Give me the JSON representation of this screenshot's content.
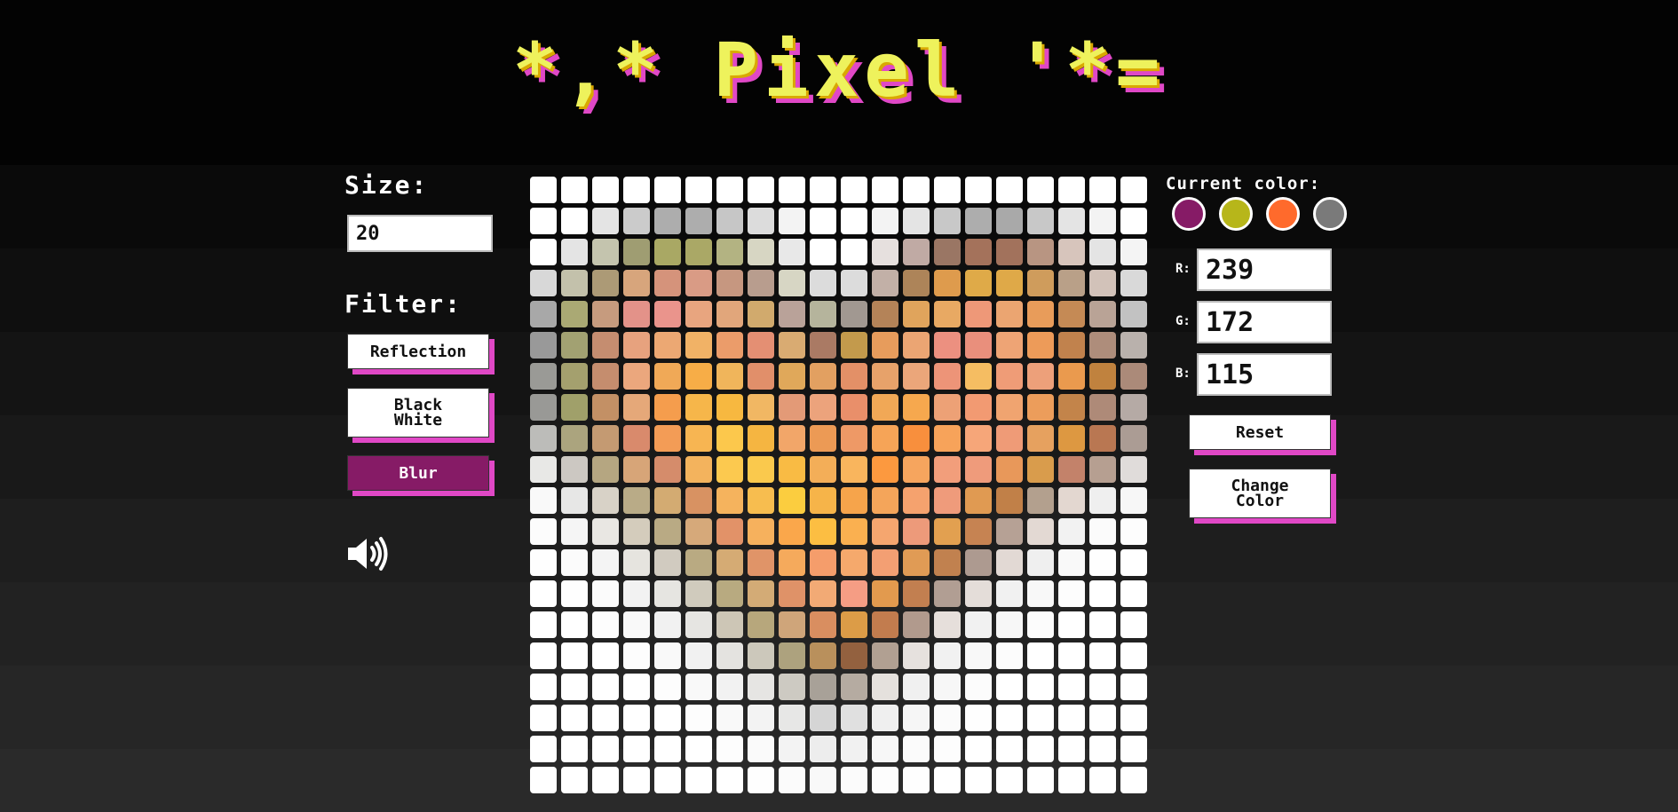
{
  "title": "*,* Pixel '*=",
  "size": {
    "label": "Size:",
    "value": "20"
  },
  "filter": {
    "label": "Filter:",
    "buttons": [
      {
        "label": "Reflection",
        "active": false
      },
      {
        "label": "Black\nWhite",
        "active": false
      },
      {
        "label": "Blur",
        "active": true
      }
    ]
  },
  "sound_icon": "speaker-volume-icon",
  "current_color": {
    "label": "Current color:",
    "swatches": [
      "#861b66",
      "#b7b61a",
      "#ff6a2c",
      "#7a7a7a"
    ]
  },
  "rgb": {
    "r_label": "R:",
    "r_value": "239",
    "g_label": "G:",
    "g_value": "172",
    "b_label": "B:",
    "b_value": "115"
  },
  "buttons": {
    "reset": "Reset",
    "change_color": "Change\nColor"
  },
  "accent_color": "#e048c6",
  "grid": [
    [
      "#ffffff",
      "#ffffff",
      "#ffffff",
      "#ffffff",
      "#ffffff",
      "#ffffff",
      "#ffffff",
      "#ffffff",
      "#ffffff",
      "#ffffff",
      "#ffffff",
      "#ffffff",
      "#ffffff",
      "#ffffff",
      "#ffffff",
      "#ffffff",
      "#ffffff",
      "#ffffff",
      "#ffffff",
      "#ffffff"
    ],
    [
      "#ffffff",
      "#ffffff",
      "#e4e4e4",
      "#cbcbcb",
      "#adadad",
      "#adadad",
      "#c6c6c6",
      "#dcdcdc",
      "#f3f3f3",
      "#ffffff",
      "#ffffff",
      "#f3f3f3",
      "#e4e4e4",
      "#c8c8c8",
      "#adadad",
      "#a9a9a9",
      "#c8c8c8",
      "#e4e4e4",
      "#f3f3f3",
      "#ffffff"
    ],
    [
      "#ffffff",
      "#e4e4e4",
      "#c4c4ae",
      "#9f9d72",
      "#a9a864",
      "#aaa866",
      "#b3b382",
      "#d7d6c3",
      "#e8e8e8",
      "#ffffff",
      "#ffffff",
      "#e6e0de",
      "#c0aaa4",
      "#9a7664",
      "#a4725b",
      "#a2725c",
      "#b89582",
      "#d7c5bc",
      "#e4e4e4",
      "#f4f4f4"
    ],
    [
      "#d8d8d8",
      "#c3c1ab",
      "#ac9a76",
      "#d7a57c",
      "#d5937b",
      "#d99b85",
      "#c69780",
      "#b89d8e",
      "#d7d6c4",
      "#dcdcdc",
      "#dcdcdc",
      "#c2b0a7",
      "#ad8459",
      "#de9b4d",
      "#dfaa48",
      "#dfa948",
      "#cf9c5c",
      "#b9a088",
      "#d2c2b9",
      "#d9d9d9"
    ],
    [
      "#a8a8a8",
      "#aaa974",
      "#c69b7e",
      "#e39289",
      "#ea948c",
      "#e8a57f",
      "#e1a67b",
      "#d1aa6d",
      "#b9a299",
      "#b5b49c",
      "#a19891",
      "#b48358",
      "#e0a45c",
      "#e8a963",
      "#ee9878",
      "#eba571",
      "#e89c5a",
      "#c58a55",
      "#b9a396",
      "#c2c2c2"
    ],
    [
      "#999999",
      "#a2a172",
      "#c58d70",
      "#e7a27e",
      "#eca873",
      "#f1b266",
      "#eb9c6a",
      "#e48f73",
      "#d9ab72",
      "#aa7a64",
      "#c39a4c",
      "#e79c5c",
      "#eba573",
      "#ec9080",
      "#e98f7c",
      "#eea475",
      "#ed9b59",
      "#c1824d",
      "#ae8d7b",
      "#b9b1ac"
    ],
    [
      "#9a9a96",
      "#a4a06e",
      "#c58d6e",
      "#eba77d",
      "#f0a957",
      "#f7ad47",
      "#f0b55b",
      "#e18f6a",
      "#e0a85a",
      "#e2a061",
      "#e39067",
      "#e7a26a",
      "#eba67a",
      "#ed9478",
      "#f5bd62",
      "#ef9c77",
      "#eda07a",
      "#ea9a4e",
      "#c0823e",
      "#ab8a79"
    ],
    [
      "#999996",
      "#a0a06a",
      "#c39065",
      "#e5a879",
      "#f59d4d",
      "#f6b64a",
      "#f7b840",
      "#f1b763",
      "#e39a77",
      "#eca37c",
      "#e98f6a",
      "#f1a856",
      "#f6a84e",
      "#eda176",
      "#f29a72",
      "#f0a470",
      "#ec9d5b",
      "#c3844a",
      "#ae8a78",
      "#b5aaa5"
    ],
    [
      "#bcbcb9",
      "#aba47e",
      "#c49a72",
      "#d98a6c",
      "#f39c56",
      "#f7b552",
      "#fcc84c",
      "#f5b541",
      "#f2a669",
      "#ec9a55",
      "#ee9966",
      "#f6a457",
      "#f88f3d",
      "#f7a35a",
      "#f6a679",
      "#ef9b77",
      "#e6a15f",
      "#dd9841",
      "#b97752",
      "#ab9c94"
    ],
    [
      "#e8e8e6",
      "#ccc8c2",
      "#b5a681",
      "#d7a578",
      "#d58c6b",
      "#f3b35d",
      "#fcc94f",
      "#fac94d",
      "#f9bb44",
      "#f3ae58",
      "#f9b55d",
      "#fc993f",
      "#f6a55e",
      "#f29e7b",
      "#ef9b7b",
      "#e8985a",
      "#d99c4c",
      "#c3826a",
      "#b69f91",
      "#e0dcda"
    ],
    [
      "#f9f9f9",
      "#e7e7e6",
      "#d8d2c7",
      "#b9ab87",
      "#d3ab72",
      "#d89262",
      "#f5b35d",
      "#f7bd4f",
      "#fbcd3f",
      "#f6b449",
      "#f6a44b",
      "#f4a55a",
      "#f5a26e",
      "#ef9b7b",
      "#e09a52",
      "#c18048",
      "#b3a08e",
      "#e3d7d0",
      "#efefef",
      "#f7f7f7"
    ],
    [
      "#fcfcfc",
      "#f5f5f5",
      "#e9e7e3",
      "#d4ccbc",
      "#b9aa84",
      "#d6a97a",
      "#e29268",
      "#f6b15d",
      "#faa74b",
      "#fcbe42",
      "#fab050",
      "#f5a66f",
      "#ed9a7a",
      "#e2a050",
      "#c68352",
      "#b6a195",
      "#e3d9d3",
      "#f2f2f2",
      "#fbfbfb",
      "#fdfdfd"
    ],
    [
      "#fefefe",
      "#fbfbfb",
      "#f4f4f4",
      "#e6e4df",
      "#d1cbc0",
      "#b9aa82",
      "#d5ab74",
      "#e09468",
      "#f5aa5c",
      "#f59d6b",
      "#f5a96c",
      "#f39f73",
      "#e09b55",
      "#c1814f",
      "#ad9a90",
      "#e2d9d4",
      "#efefef",
      "#f9f9f9",
      "#fefefe",
      "#ffffff"
    ],
    [
      "#ffffff",
      "#fefefe",
      "#fbfbfb",
      "#f2f2f2",
      "#e6e5e1",
      "#d0cbbd",
      "#b8aa80",
      "#d3ab76",
      "#df9268",
      "#f2aa75",
      "#f59d84",
      "#e29a4e",
      "#c27f50",
      "#b19e93",
      "#e4ddd9",
      "#f1f1f1",
      "#f8f8f8",
      "#fdfdfd",
      "#ffffff",
      "#ffffff"
    ],
    [
      "#ffffff",
      "#ffffff",
      "#fdfdfd",
      "#f9f9f9",
      "#f1f1f1",
      "#e6e5e2",
      "#cdc6b6",
      "#b7a77c",
      "#cfa57a",
      "#d98e60",
      "#dc9c47",
      "#c27c4e",
      "#b19a8d",
      "#e6dfdb",
      "#f1f1f1",
      "#f7f7f7",
      "#fcfcfc",
      "#ffffff",
      "#ffffff",
      "#ffffff"
    ],
    [
      "#ffffff",
      "#ffffff",
      "#ffffff",
      "#fdfdfd",
      "#f9f9f9",
      "#f1f1f1",
      "#e4e3e0",
      "#ccc8bb",
      "#ada27e",
      "#b9905c",
      "#93613f",
      "#b1a092",
      "#e6e1de",
      "#f1f1f1",
      "#f8f8f8",
      "#fcfcfc",
      "#ffffff",
      "#ffffff",
      "#ffffff",
      "#ffffff"
    ],
    [
      "#ffffff",
      "#ffffff",
      "#ffffff",
      "#ffffff",
      "#fdfdfd",
      "#f9f9f9",
      "#f2f2f2",
      "#e6e5e3",
      "#cdcac2",
      "#a8a198",
      "#b5aba1",
      "#e5e1dd",
      "#f0f0f0",
      "#f7f7f7",
      "#fcfcfc",
      "#ffffff",
      "#ffffff",
      "#ffffff",
      "#ffffff",
      "#ffffff"
    ],
    [
      "#ffffff",
      "#ffffff",
      "#ffffff",
      "#ffffff",
      "#ffffff",
      "#fdfdfd",
      "#f9f9f9",
      "#f3f3f3",
      "#e7e7e6",
      "#d5d5d5",
      "#e0e0e0",
      "#efefef",
      "#f6f6f6",
      "#fbfbfb",
      "#fefefe",
      "#ffffff",
      "#ffffff",
      "#ffffff",
      "#ffffff",
      "#ffffff"
    ],
    [
      "#ffffff",
      "#ffffff",
      "#ffffff",
      "#ffffff",
      "#ffffff",
      "#ffffff",
      "#fdfdfd",
      "#fafafa",
      "#f3f3f3",
      "#ededed",
      "#f1f1f1",
      "#f7f7f7",
      "#fbfbfb",
      "#fdfdfd",
      "#ffffff",
      "#ffffff",
      "#ffffff",
      "#ffffff",
      "#ffffff",
      "#ffffff"
    ],
    [
      "#ffffff",
      "#ffffff",
      "#ffffff",
      "#ffffff",
      "#ffffff",
      "#ffffff",
      "#ffffff",
      "#fefefe",
      "#fbfbfb",
      "#f9f9f9",
      "#fbfbfb",
      "#fdfdfd",
      "#fefefe",
      "#ffffff",
      "#ffffff",
      "#ffffff",
      "#ffffff",
      "#ffffff",
      "#ffffff",
      "#ffffff"
    ]
  ]
}
